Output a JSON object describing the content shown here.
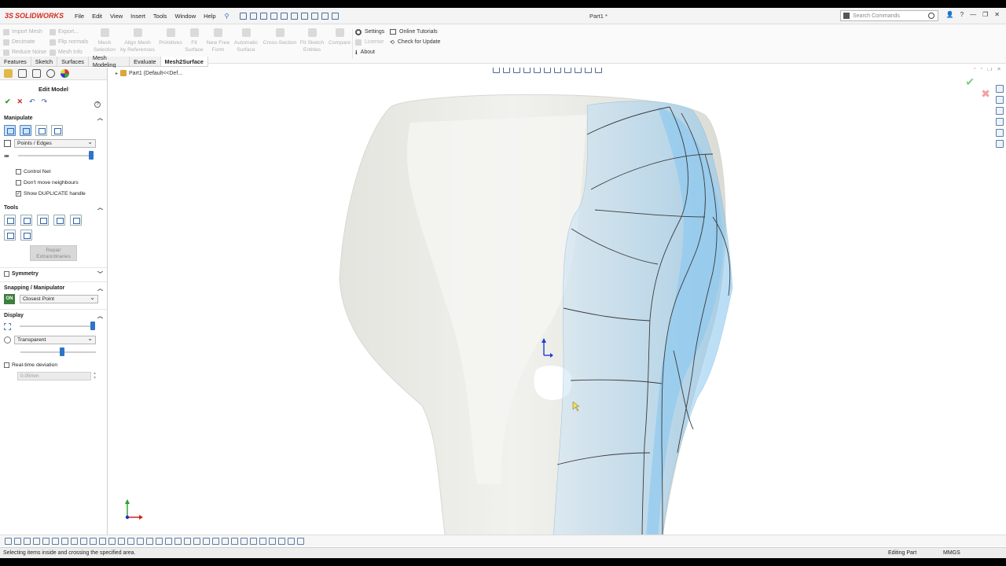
{
  "app": {
    "brand": "SOLIDWORKS",
    "doc_title": "Part1 *",
    "menu": [
      "File",
      "Edit",
      "View",
      "Insert",
      "Tools",
      "Window",
      "Help"
    ],
    "search_placeholder": "Search Commands"
  },
  "command_manager": {
    "col1": [
      "Import Mesh",
      "Decimate",
      "Reduce Noise"
    ],
    "col2": [
      "Export...",
      "Flip normals",
      "Mesh Info"
    ],
    "big_buttons": [
      {
        "label1": "Mesh",
        "label2": "Selection"
      },
      {
        "label1": "Align Mesh",
        "label2": "by References"
      },
      {
        "label1": "Primitives",
        "label2": ""
      },
      {
        "label1": "Fit",
        "label2": "Surface"
      },
      {
        "label1": "New Free",
        "label2": "Form"
      },
      {
        "label1": "Automatic",
        "label2": "Surface"
      },
      {
        "label1": "Cross-Section",
        "label2": ""
      },
      {
        "label1": "Fit Sketch",
        "label2": "Entities"
      },
      {
        "label1": "Compare",
        "label2": ""
      }
    ],
    "links_a": {
      "settings": "Settings",
      "license": "License",
      "about": "About"
    },
    "links_b": {
      "tutorials": "Online Tutorials",
      "update": "Check for Update"
    }
  },
  "tabs": [
    "Features",
    "Sketch",
    "Surfaces",
    "Mesh Modeling",
    "Evaluate",
    "Mesh2Surface"
  ],
  "active_tab": "Mesh2Surface",
  "panel": {
    "title": "Edit Model",
    "manipulate": {
      "header": "Manipulate",
      "mode": "Points / Edges",
      "slider_level": 1.0,
      "control_net": "Control Net",
      "dont_move": "Don't move neighbours",
      "show_duplicate": "Show DUPLICATE handle"
    },
    "tools": {
      "header": "Tools",
      "repair_1": "Repair",
      "repair_2": "Extraordinaries"
    },
    "symmetry": "Symmetry",
    "snapping": {
      "header": "Snapping / Manipulator",
      "on": "ON",
      "mode": "Closest Point"
    },
    "display": {
      "header": "Display",
      "mode": "Transparent",
      "slider1": 1.0,
      "slider2": 0.55
    },
    "deviation": {
      "label": "Real-time deviation",
      "value": "0.05mm"
    }
  },
  "viewport": {
    "tree_label": "Part1  (Default<<Def..."
  },
  "status": {
    "message": "Selecting items inside and crossing the specified area.",
    "mode": "Editing Part",
    "units": "MMGS"
  },
  "colors": {
    "accent": "#2e74c8",
    "brand_red": "#d52b1e",
    "mesh_blue": "#8fc9f0"
  }
}
